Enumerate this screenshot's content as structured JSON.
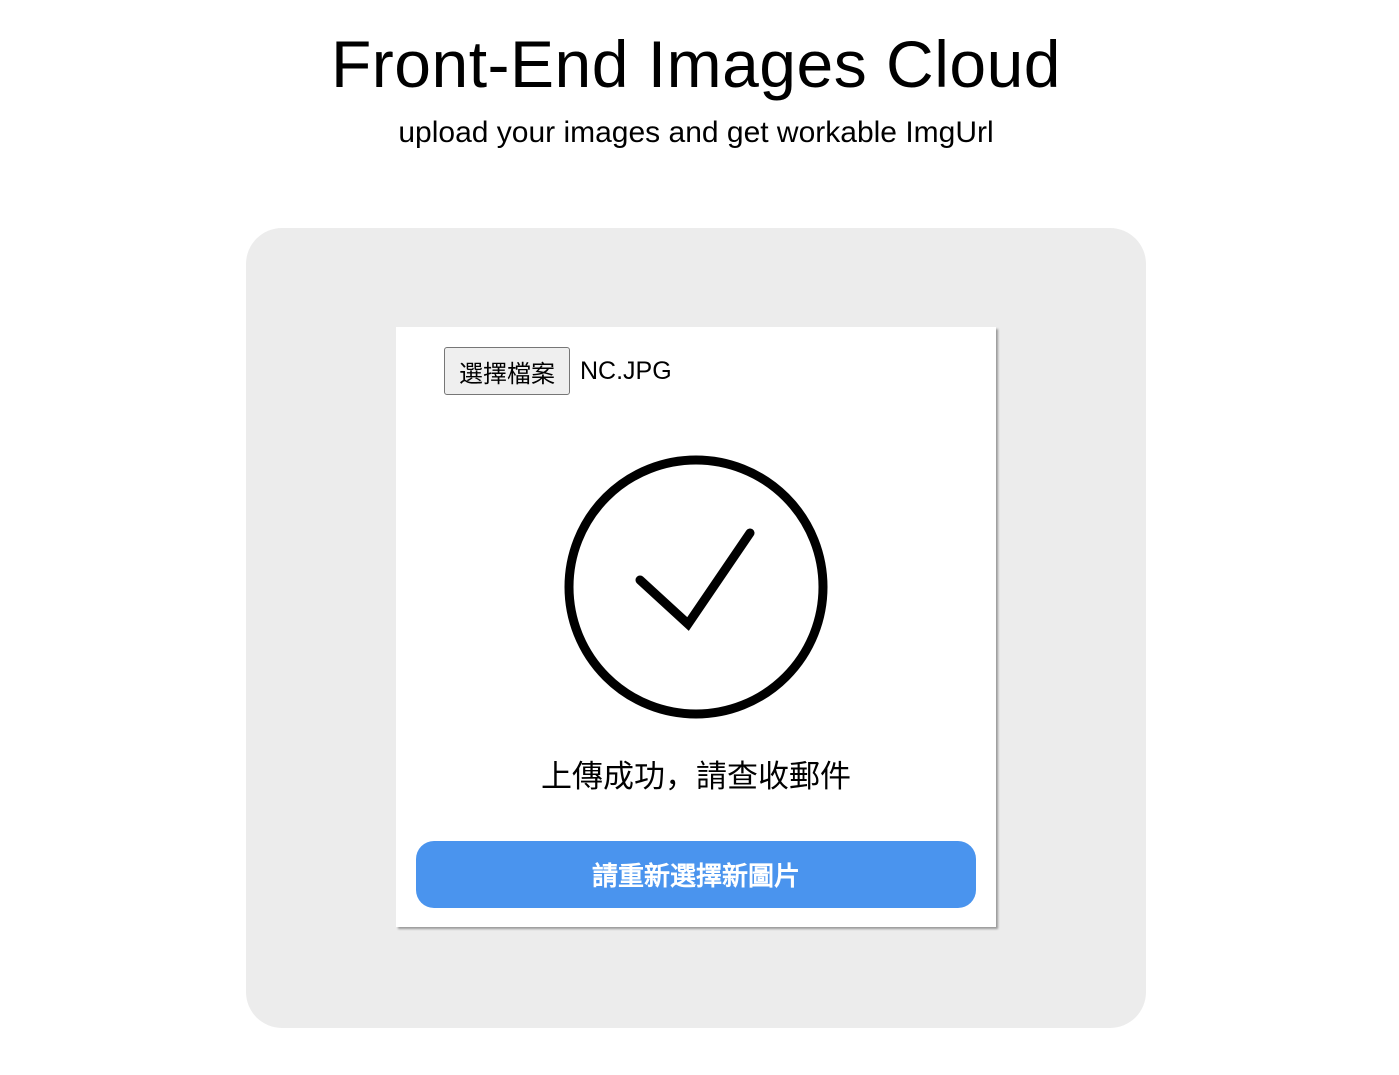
{
  "header": {
    "title": "Front-End Images Cloud",
    "subtitle": "upload your images and get workable ImgUrl"
  },
  "upload": {
    "choose_file_label": "選擇檔案",
    "file_name": "NC.JPG",
    "status_icon": "check-circle-icon",
    "status_message": "上傳成功，請查收郵件",
    "reselect_label": "請重新選擇新圖片"
  },
  "colors": {
    "panel_background": "#ececec",
    "card_background": "#ffffff",
    "primary_button": "#4a94ee",
    "icon_stroke": "#000000"
  }
}
